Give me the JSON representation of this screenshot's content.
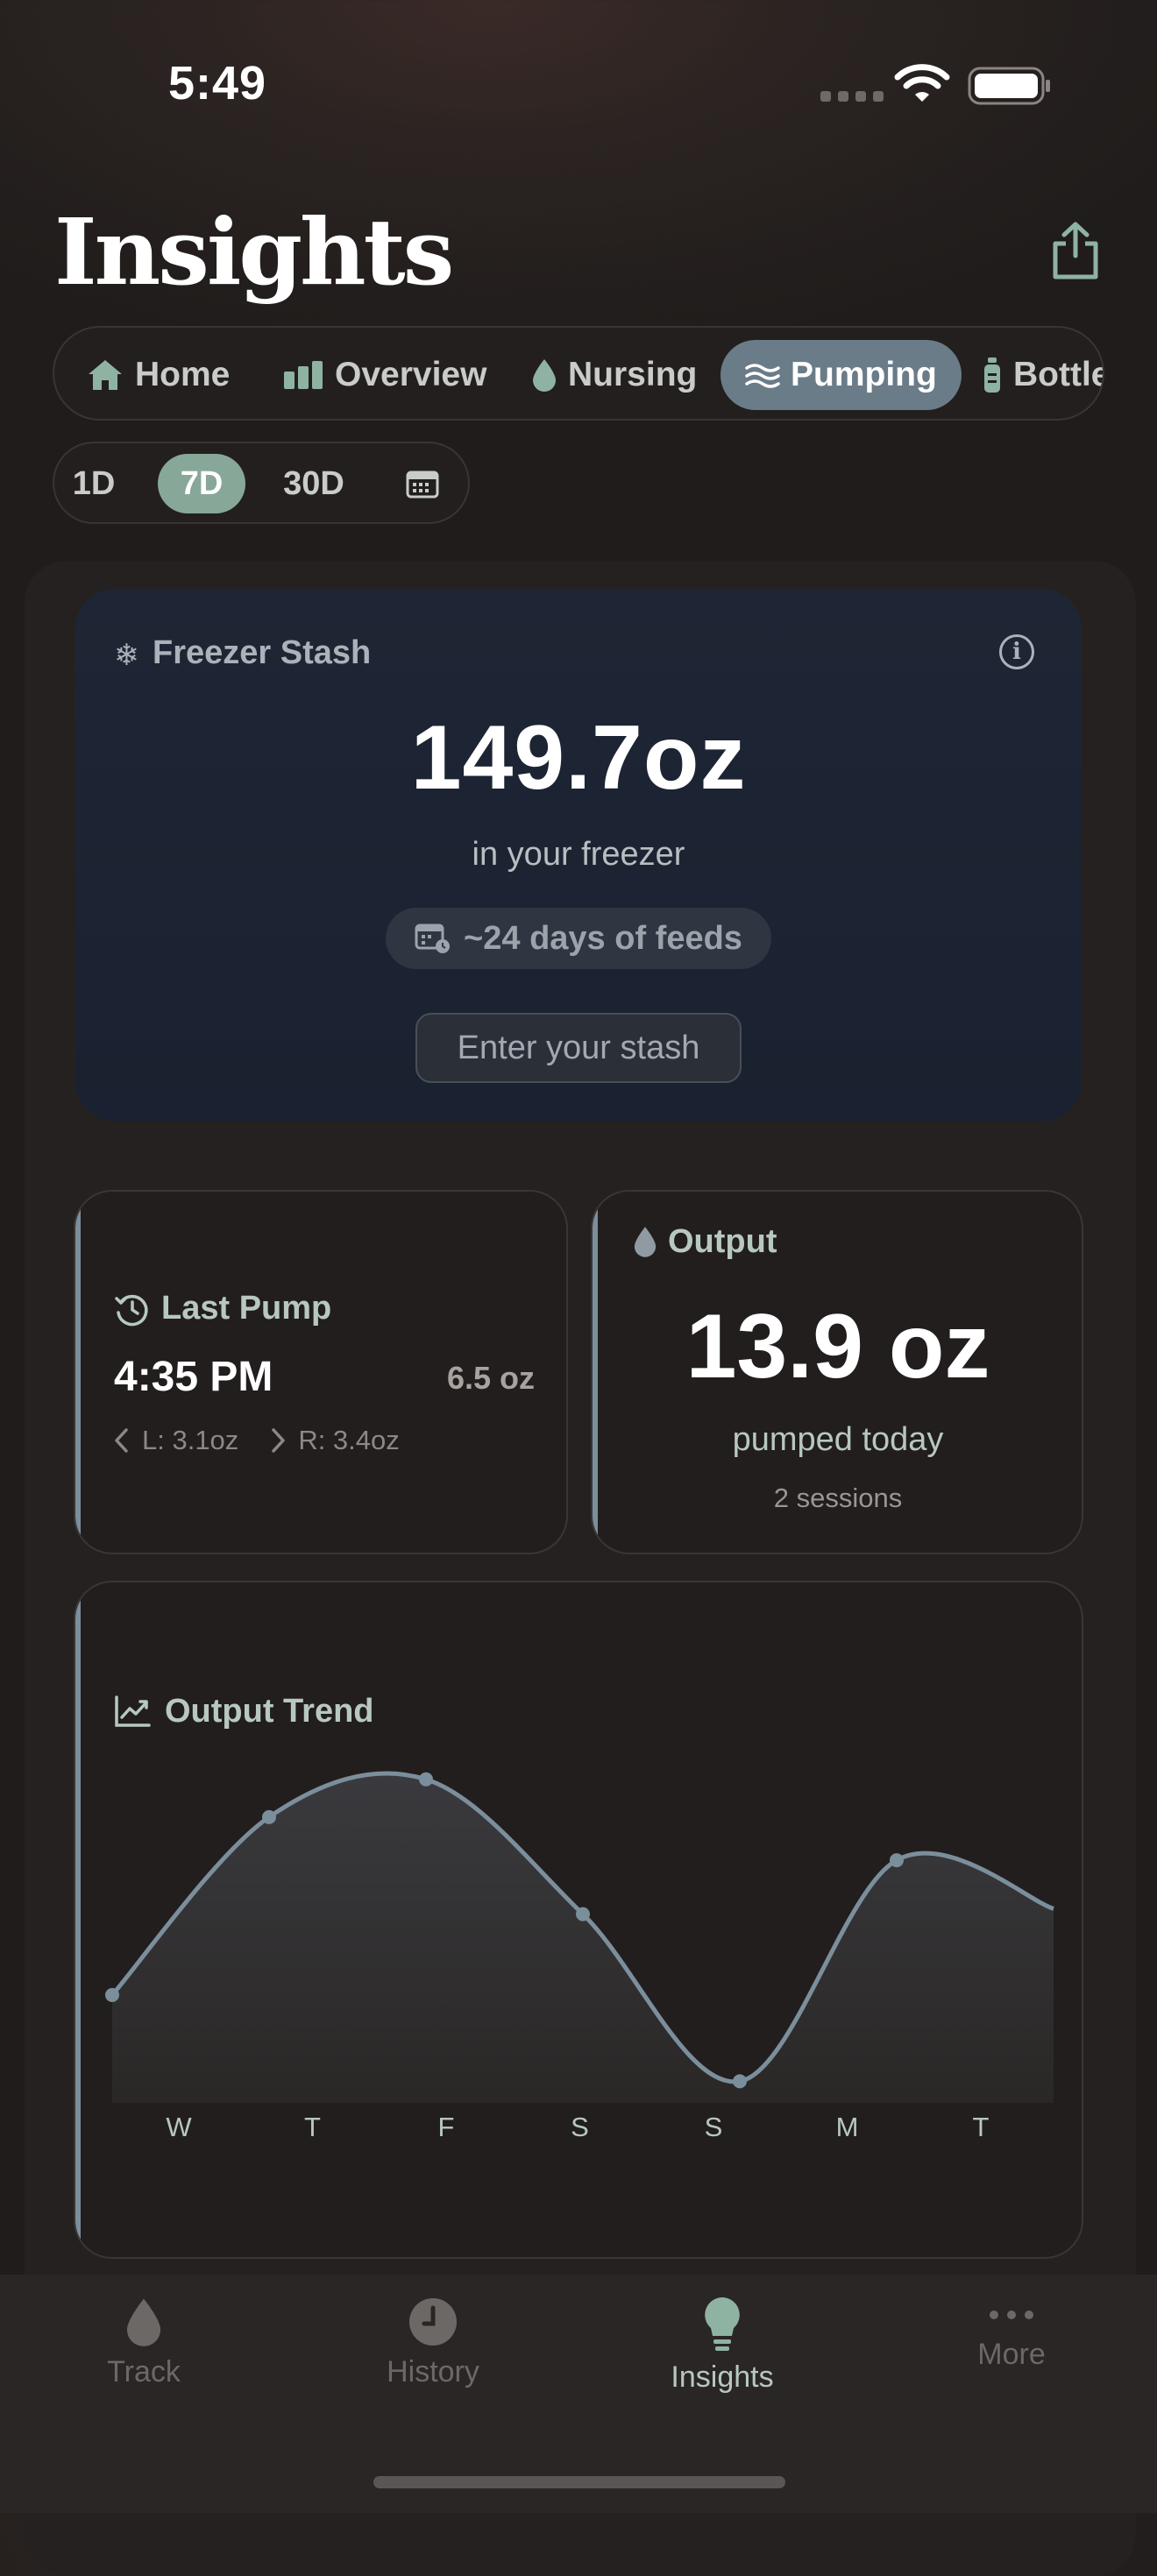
{
  "status_bar": {
    "time": "5:49"
  },
  "header": {
    "title": "Insights"
  },
  "tabs": [
    {
      "label": "Home",
      "icon": "home-icon"
    },
    {
      "label": "Overview",
      "icon": "bars-icon"
    },
    {
      "label": "Nursing",
      "icon": "drop-icon"
    },
    {
      "label": "Pumping",
      "icon": "waves-icon",
      "active": true
    },
    {
      "label": "Bottle",
      "icon": "bottle-icon"
    }
  ],
  "range": {
    "options": [
      "1D",
      "7D",
      "30D"
    ],
    "selected": "7D"
  },
  "freezer": {
    "label": "Freezer Stash",
    "amount": "149.7oz",
    "subtitle": "in your freezer",
    "days": "~24 days of feeds",
    "button": "Enter your stash"
  },
  "last_pump": {
    "label": "Last Pump",
    "time": "4:35 PM",
    "amount": "6.5 oz",
    "left": "L: 3.1oz",
    "right": "R: 3.4oz"
  },
  "output": {
    "label": "Output",
    "value": "13.9 oz",
    "subtitle": "pumped today",
    "sessions": "2 sessions"
  },
  "trend": {
    "label": "Output Trend"
  },
  "chart_data": {
    "type": "line",
    "title": "Output Trend",
    "categories": [
      "W",
      "T",
      "F",
      "S",
      "S",
      "M",
      "T"
    ],
    "values": [
      11.5,
      14.8,
      15.5,
      13.0,
      9.9,
      14.0,
      13.1
    ],
    "ylim": [
      9.5,
      16
    ],
    "grid": false,
    "accent": "#7b8e9c"
  },
  "bottom_nav": [
    {
      "label": "Track",
      "icon": "drop-icon"
    },
    {
      "label": "History",
      "icon": "clock-icon"
    },
    {
      "label": "Insights",
      "icon": "lightbulb-icon",
      "active": true
    },
    {
      "label": "More",
      "icon": "more-icon"
    }
  ],
  "colors": {
    "accent": "#87a898",
    "pumping": "#6a7c88",
    "background": "#1e1c1b"
  }
}
